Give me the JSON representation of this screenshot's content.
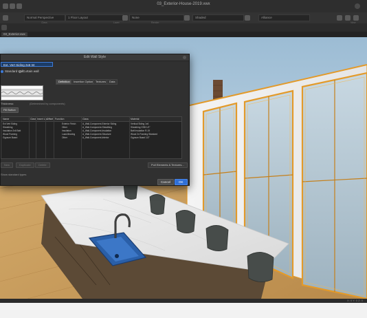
{
  "window": {
    "title": "03_Exterior-House-2019.vwx"
  },
  "toolbar": {
    "class": "Normal Perspective",
    "layer": "1 Floor Layout",
    "render": "None",
    "lighting": "Shaded",
    "view": "Alliance",
    "class_label": "Class",
    "layer_label": "Layer",
    "render_label": "Render",
    "view_label": "View"
  },
  "tabs": {
    "active": "03_Exterior.vwx"
  },
  "dialog": {
    "title": "Edit Wall Style",
    "style_name": "Ext. Vert Siding 2x6 Int",
    "radio_standard": "Standard wall",
    "radio_curtain": "Curtain wall",
    "tabs": [
      "Definition",
      "Insertion Options",
      "Textures",
      "Data"
    ],
    "preview_note": "(Determined by components)",
    "thickness_label": "Thickness:",
    "fill_button": "Fill Button",
    "columns": [
      "Name",
      "Class",
      "Insert Loc.",
      "Offset",
      "Function",
      "Class",
      "Material"
    ],
    "rows": [
      {
        "name": "Ext Vert Siding",
        "function": "Exterior Finish",
        "class": "A_Wall-Component-Exterior Siding",
        "material": "Vertical Siding 1x6"
      },
      {
        "name": "Sheathing",
        "function": "Other",
        "class": "A_Wall-Component-Sheathing",
        "material": "Sheathing OSB 1/2\""
      },
      {
        "name": "Insulation 2x6 Batt",
        "function": "Insulation",
        "class": "A_Wall-Component-Insulation",
        "material": "Batt Insulation R-19"
      },
      {
        "name": "Wood Framing",
        "function": "Load-Bearing",
        "class": "A_Wall-Component-Structure",
        "material": "Wood 2x Framing Standard"
      },
      {
        "name": "Gypsum Board",
        "function": "Other",
        "class": "A_Wall-Component-Interior",
        "material": "Gypsum Board 1/2\""
      }
    ],
    "buttons": {
      "new": "New",
      "duplicate": "Duplicate",
      "delete": "Delete",
      "pull": "Pull Elements & Textures...",
      "cancel": "Cancel",
      "ok": "OK"
    },
    "footer": "Show standard types"
  },
  "status": {
    "right": "X: 0 Y: 0 Z: 0"
  },
  "colors": {
    "accent": "#2f6fd6",
    "counter": "#ececec",
    "window_frame": "#e39a2a"
  }
}
